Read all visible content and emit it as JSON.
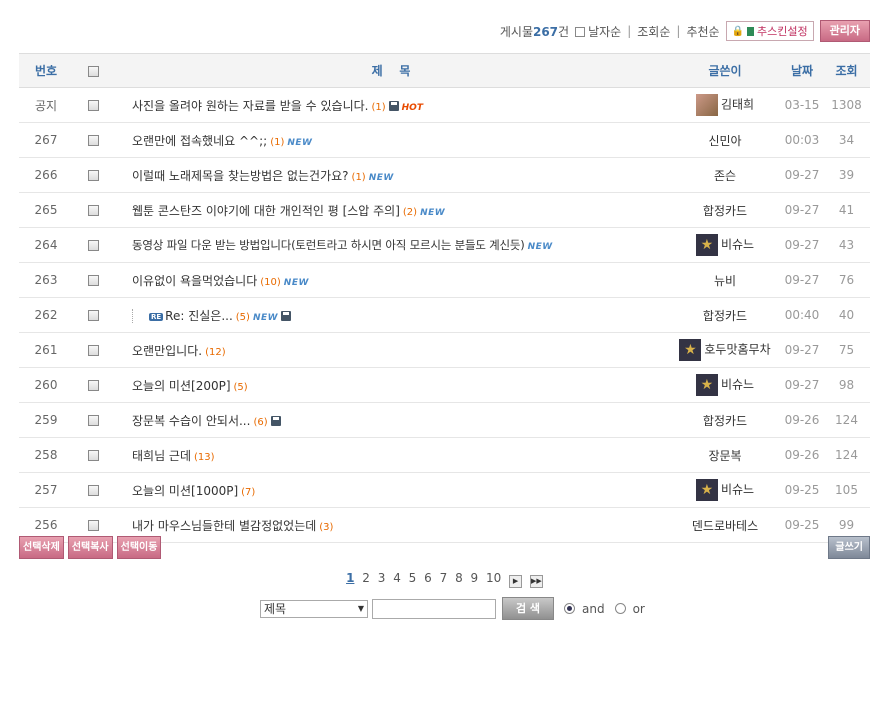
{
  "top": {
    "count_prefix": "게시물",
    "count_num": "267",
    "count_suffix": "건",
    "sort_date": "날자순",
    "sort_views": "조회순",
    "sort_recommend": "추천순",
    "skin_setting": "추스킨설정",
    "admin": "관리자"
  },
  "header": {
    "no": "번호",
    "title": "제    목",
    "author": "글쓴이",
    "date": "날짜",
    "views": "조회"
  },
  "rows": [
    {
      "no": "공지",
      "title": "사진을 올려야 원하는 자료를 받을 수 있습니다.",
      "comments": "(1)",
      "author": "김태희",
      "date": "03-15",
      "views": "1308"
    },
    {
      "no": "267",
      "title": "오랜만에 접속했네요 ^^;;",
      "comments": "(1)",
      "author": "신민아",
      "date": "00:03",
      "views": "34"
    },
    {
      "no": "266",
      "title": "이럴때 노래제목을 찾는방법은 없는건가요?",
      "comments": "(1)",
      "author": "존슨",
      "date": "09-27",
      "views": "39"
    },
    {
      "no": "265",
      "title": "웹툰 콘스탄즈 이야기에 대한 개인적인 평 [스압 주의]",
      "comments": "(2)",
      "author": "합정카드",
      "date": "09-27",
      "views": "41"
    },
    {
      "no": "264",
      "title": "동영상 파일 다운 받는 방법입니다(토런트라고 하시면 아직 모르시는 분들도 계신듯)",
      "comments": "",
      "author": "비슈느",
      "date": "09-27",
      "views": "43"
    },
    {
      "no": "263",
      "title": "이유없이 욕을먹었습니다",
      "comments": "(10)",
      "author": "뉴비",
      "date": "09-27",
      "views": "76"
    },
    {
      "no": "262",
      "title": "Re: 진실은...",
      "comments": "(5)",
      "author": "합정카드",
      "date": "00:40",
      "views": "40"
    },
    {
      "no": "261",
      "title": "오랜만입니다.",
      "comments": "(12)",
      "author": "호두맛홈무차",
      "date": "09-27",
      "views": "75"
    },
    {
      "no": "260",
      "title": "오늘의 미션[200P]",
      "comments": "(5)",
      "author": "비슈느",
      "date": "09-27",
      "views": "98"
    },
    {
      "no": "259",
      "title": "장문복 수습이 안되서...",
      "comments": "(6)",
      "author": "합정카드",
      "date": "09-26",
      "views": "124"
    },
    {
      "no": "258",
      "title": "태희님 근데",
      "comments": "(13)",
      "author": "장문복",
      "date": "09-26",
      "views": "124"
    },
    {
      "no": "257",
      "title": "오늘의 미션[1000P]",
      "comments": "(7)",
      "author": "비슈느",
      "date": "09-25",
      "views": "105"
    },
    {
      "no": "256",
      "title": "내가 마우스님들한테 별감정없었는데",
      "comments": "(3)",
      "author": "덴드로바테스",
      "date": "09-25",
      "views": "99"
    }
  ],
  "badges": {
    "new": "NEW",
    "hot": "HOT",
    "re": "RE"
  },
  "buttons": {
    "delete": "선택삭제",
    "copy": "선택복사",
    "move": "선택이동",
    "write": "글쓰기"
  },
  "pager": {
    "pages": [
      "1",
      "2",
      "3",
      "4",
      "5",
      "6",
      "7",
      "8",
      "9",
      "10"
    ],
    "current": "1"
  },
  "search": {
    "field": "제목",
    "submit": "검 색",
    "and": "and",
    "or": "or"
  }
}
